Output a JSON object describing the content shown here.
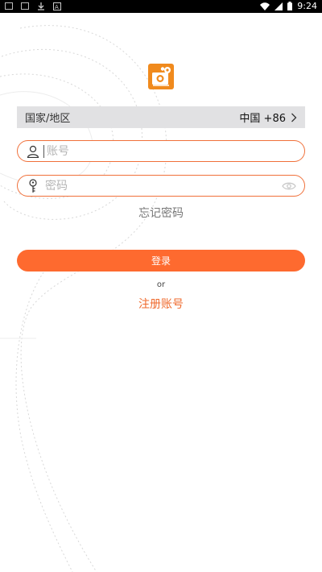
{
  "status_bar": {
    "time": "9:24",
    "icons": [
      "notification-icon",
      "mail-icon",
      "download-icon",
      "app-icon",
      "wifi-icon",
      "signal-icon",
      "battery-icon"
    ]
  },
  "logo": {
    "icon": "camera-gear-icon",
    "color": "#f08a1d"
  },
  "country": {
    "label": "国家/地区",
    "value": "中国 +86",
    "icon": "chevron-right-icon"
  },
  "account": {
    "placeholder": "账号",
    "icon": "user-icon"
  },
  "password": {
    "placeholder": "密码",
    "icon": "key-icon",
    "toggle_icon": "eye-icon"
  },
  "forgot_label": "忘记密码",
  "login_label": "登录",
  "or_label": "or",
  "register_label": "注册账号",
  "colors": {
    "accent": "#fe6a2f",
    "border": "#f0703a",
    "country_bg": "#e1e1e3"
  }
}
